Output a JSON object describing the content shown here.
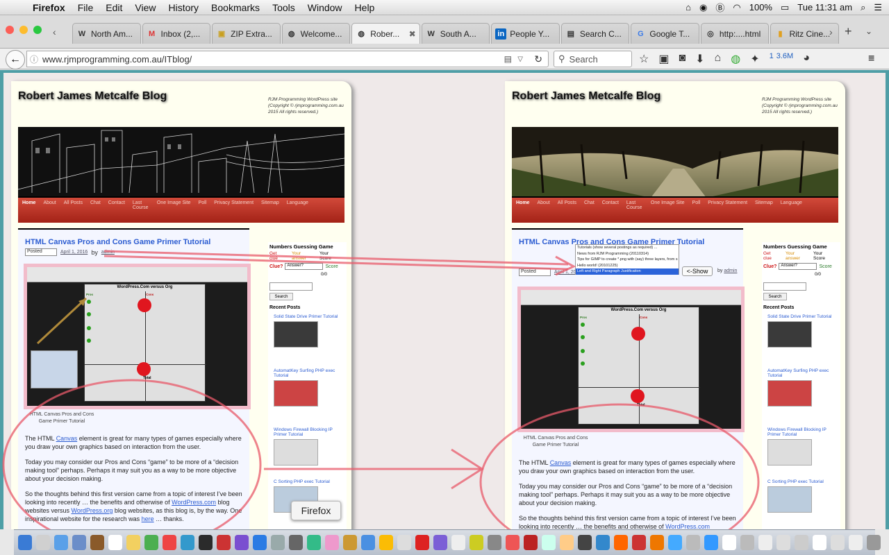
{
  "menubar": {
    "app": "Firefox",
    "items": [
      "File",
      "Edit",
      "View",
      "History",
      "Bookmarks",
      "Tools",
      "Window",
      "Help"
    ],
    "battery": "100%",
    "clock": "Tue 11:31 am"
  },
  "tabs": [
    {
      "label": "North Am...",
      "icon": "wikipedia-icon"
    },
    {
      "label": "Inbox (2,...",
      "icon": "gmail-icon"
    },
    {
      "label": "ZIP Extra...",
      "icon": "zip-icon"
    },
    {
      "label": "Welcome...",
      "icon": "page-icon"
    },
    {
      "label": "Rober...",
      "icon": "page-icon",
      "active": true
    },
    {
      "label": "South A...",
      "icon": "wikipedia-icon"
    },
    {
      "label": "People Y...",
      "icon": "linkedin-icon"
    },
    {
      "label": "Search C...",
      "icon": "search-console-icon"
    },
    {
      "label": "Google T...",
      "icon": "translate-icon"
    },
    {
      "label": "http:....html",
      "icon": "globe-icon"
    },
    {
      "label": "Ritz Cine...",
      "icon": "cinema-icon"
    }
  ],
  "navbar": {
    "url": "www.rjmprogramming.com.au/ITblog/",
    "search_placeholder": "Search",
    "download_size": "3.6M",
    "counter": "1"
  },
  "blog": {
    "title": "Robert James Metcalfe Blog",
    "copyright": "RJM Programming WordPress site (Copyright © rjmprogramming.com.au 2015 All rights reserved.)",
    "nav": [
      "Home",
      "About",
      "All Posts",
      "Chat",
      "Contact",
      "Last Course",
      "One Image Site",
      "Poll",
      "Privacy Statement",
      "Sitemap",
      "Language"
    ],
    "post_title": "HTML Canvas Pros and Cons Game Primer Tutorial",
    "posted_label": "Posted",
    "posted_date": "April 1, 2016",
    "by": "by",
    "author": "admin",
    "image_caption": "HTML Canvas Pros and Cons Game Primer Tutorial",
    "board_title": "WordPress.Com versus Org",
    "pros_label": "Pros",
    "cons_label": "Cons",
    "pros_items": [
      "Simplicity",
      "Price",
      "Time to Implement",
      "Spam control",
      "Administrative load"
    ],
    "cons_items": [
      "Do It Yourself",
      "Domain name authority",
      "Advertising control",
      "Third party control",
      "Theme variety"
    ],
    "total_label": "Total",
    "p1_pre": "The HTML ",
    "p1_link": "Canvas",
    "p1_post": " element is great for many types of games especially where you draw your own graphics based on interaction from the user.",
    "p2": "Today you may consider our Pros and Cons “game” to be more of a “decision making tool” perhaps. Perhaps it may suit you as a way to be more objective about your decision making.",
    "p3_a": "So the thoughts behind this first version came from a topic of interest I’ve been looking into recently … the benefits and otherwise of ",
    "p3_link1": "WordPress.com",
    "p3_b": " blog websites versus ",
    "p3_link2": "WordPress.org",
    "p3_c": " blog websites, as this blog is, by the way. One inspirational website for the research was ",
    "p3_link3": "here",
    "p3_d": " … thanks.",
    "sidebar": {
      "game_title": "Numbers Guessing Game",
      "col1": "Get clue",
      "col2": "Your answer",
      "col3": "Your Score",
      "clue_label": "Clue?",
      "answer_select": "Answer?",
      "score_label": "Score",
      "score_value": "0/0",
      "search_button": "Search",
      "recent_posts": "Recent Posts",
      "posts": [
        "Solid State Drive Primer Tutorial",
        "AutomatKey Surfing PHP exec Tutorial",
        "Windows Firewall Blocking IP Primer Tutorial",
        "C Sorting PHP exec Tutorial"
      ]
    }
  },
  "dropdown": {
    "options": [
      "Tutorials (show several postings as required) ...",
      "News from RJM Programming (20110314)",
      "Tips for GIMP to create *.png with (say) three layers, from s",
      "Hello world! (20101225)",
      "Left and Right Paragraph Justification"
    ],
    "selected_index": 4,
    "show_button": "<-Show"
  },
  "tooltip": "Firefox",
  "colors": {
    "blog_nav": "#b8291c",
    "link": "#2a5bd1",
    "annotation": "#e85a6a",
    "page_frame": "#4f9ea6"
  }
}
